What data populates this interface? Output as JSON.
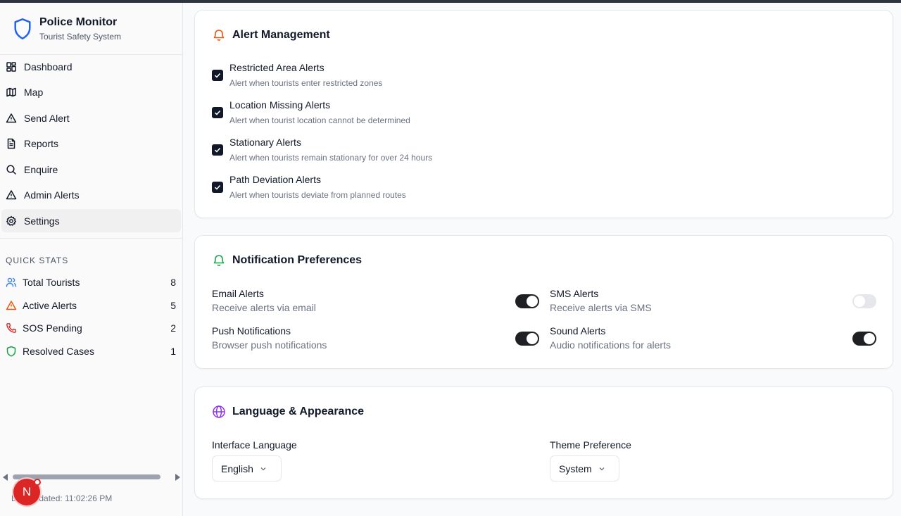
{
  "app": {
    "title": "Police Monitor",
    "subtitle": "Tourist Safety System"
  },
  "nav": [
    {
      "label": "Dashboard",
      "icon": "dashboard-icon"
    },
    {
      "label": "Map",
      "icon": "map-icon"
    },
    {
      "label": "Send Alert",
      "icon": "alert-triangle-icon"
    },
    {
      "label": "Reports",
      "icon": "file-text-icon"
    },
    {
      "label": "Enquire",
      "icon": "search-icon"
    },
    {
      "label": "Admin Alerts",
      "icon": "alert-triangle-icon"
    },
    {
      "label": "Settings",
      "icon": "gear-icon",
      "active": true
    }
  ],
  "quick_stats": {
    "heading": "QUICK STATS",
    "items": [
      {
        "label": "Total Tourists",
        "value": "8",
        "icon": "users-icon",
        "color": "#3b82f6"
      },
      {
        "label": "Active Alerts",
        "value": "5",
        "icon": "alert-triangle-icon",
        "color": "#ea580c"
      },
      {
        "label": "SOS Pending",
        "value": "2",
        "icon": "phone-icon",
        "color": "#dc2626"
      },
      {
        "label": "Resolved Cases",
        "value": "1",
        "icon": "shield-icon",
        "color": "#16a34a"
      }
    ]
  },
  "footer": {
    "updated": "Last updated: 11:02:26 PM",
    "avatar": "N"
  },
  "alert_management": {
    "title": "Alert Management",
    "items": [
      {
        "title": "Restricted Area Alerts",
        "desc": "Alert when tourists enter restricted zones",
        "checked": true
      },
      {
        "title": "Location Missing Alerts",
        "desc": "Alert when tourist location cannot be determined",
        "checked": true
      },
      {
        "title": "Stationary Alerts",
        "desc": "Alert when tourists remain stationary for over 24 hours",
        "checked": true
      },
      {
        "title": "Path Deviation Alerts",
        "desc": "Alert when tourists deviate from planned routes",
        "checked": true
      }
    ]
  },
  "notifications": {
    "title": "Notification Preferences",
    "items": [
      {
        "title": "Email Alerts",
        "desc": "Receive alerts via email",
        "enabled": true
      },
      {
        "title": "SMS Alerts",
        "desc": "Receive alerts via SMS",
        "enabled": false
      },
      {
        "title": "Push Notifications",
        "desc": "Browser push notifications",
        "enabled": true
      },
      {
        "title": "Sound Alerts",
        "desc": "Audio notifications for alerts",
        "enabled": true
      }
    ]
  },
  "appearance": {
    "title": "Language & Appearance",
    "language_label": "Interface Language",
    "language_value": "English",
    "theme_label": "Theme Preference",
    "theme_value": "System"
  },
  "colors": {
    "accent_dark": "#111827",
    "bell_orange": "#ea580c",
    "bell_green": "#16a34a",
    "globe_purple": "#9333ea",
    "brand_blue": "#2563eb"
  }
}
